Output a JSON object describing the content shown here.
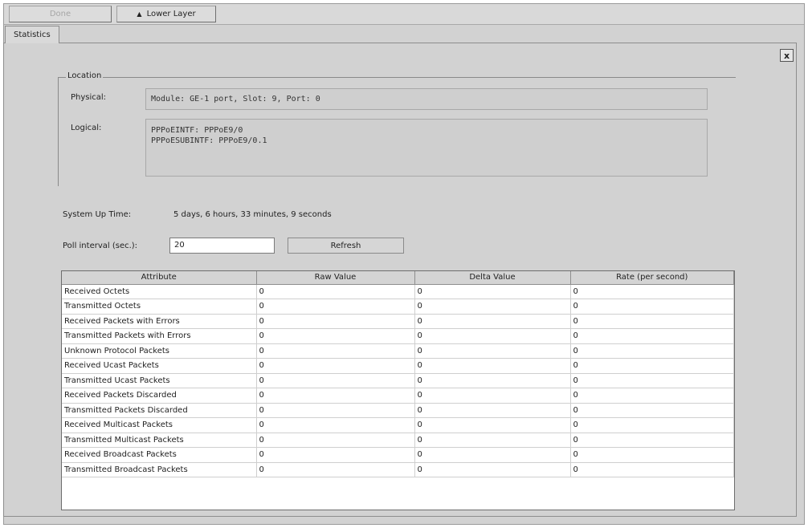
{
  "toolbar": {
    "disabled_label": "Done",
    "lower_layer_label": "Lower Layer"
  },
  "tab": {
    "label": "Statistics"
  },
  "close_label": "x",
  "location": {
    "title": "Location",
    "physical_label": "Physical:",
    "physical_value": "Module: GE-1 port, Slot: 9, Port: 0",
    "logical_label": "Logical:",
    "logical_line1": "PPPoEINTF: PPPoE9/0",
    "logical_line2": "PPPoESUBINTF: PPPoE9/0.1"
  },
  "uptime": {
    "label": "System Up Time:",
    "value": "5 days, 6 hours, 33 minutes, 9 seconds"
  },
  "poll": {
    "label": "Poll interval (sec.):",
    "value": "20",
    "refresh_label": "Refresh"
  },
  "table": {
    "columns": [
      "Attribute",
      "Raw Value",
      "Delta Value",
      "Rate (per second)"
    ],
    "rows": [
      [
        "Received Octets",
        "0",
        "0",
        "0"
      ],
      [
        "Transmitted Octets",
        "0",
        "0",
        "0"
      ],
      [
        "Received Packets with Errors",
        "0",
        "0",
        "0"
      ],
      [
        "Transmitted Packets with Errors",
        "0",
        "0",
        "0"
      ],
      [
        "Unknown Protocol Packets",
        "0",
        "0",
        "0"
      ],
      [
        "Received Ucast Packets",
        "0",
        "0",
        "0"
      ],
      [
        "Transmitted Ucast Packets",
        "0",
        "0",
        "0"
      ],
      [
        "Received Packets Discarded",
        "0",
        "0",
        "0"
      ],
      [
        "Transmitted Packets Discarded",
        "0",
        "0",
        "0"
      ],
      [
        "Received Multicast Packets",
        "0",
        "0",
        "0"
      ],
      [
        "Transmitted Multicast Packets",
        "0",
        "0",
        "0"
      ],
      [
        "Received Broadcast Packets",
        "0",
        "0",
        "0"
      ],
      [
        "Transmitted Broadcast Packets",
        "0",
        "0",
        "0"
      ]
    ]
  }
}
